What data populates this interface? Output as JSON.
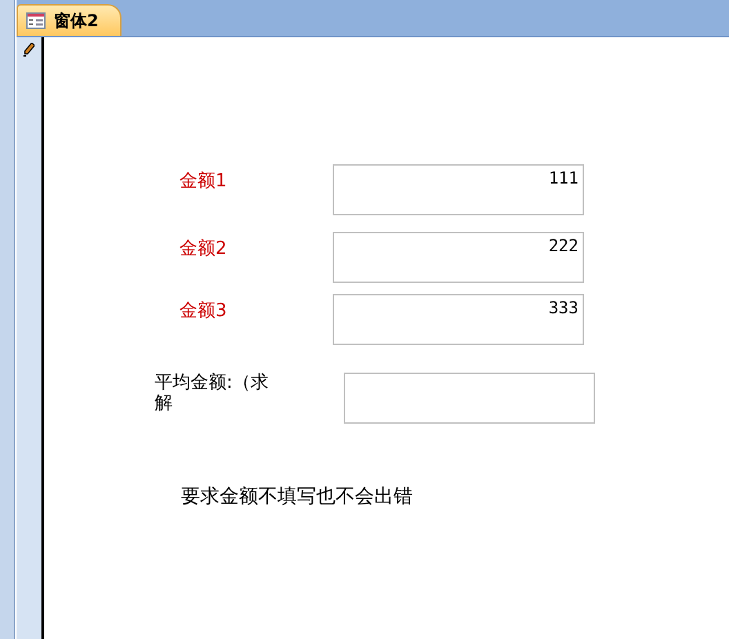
{
  "tab": {
    "title": "窗体2",
    "selected": true
  },
  "fields": [
    {
      "label": "金额1",
      "value": "111"
    },
    {
      "label": "金额2",
      "value": "222"
    },
    {
      "label": "金额3",
      "value": "333"
    }
  ],
  "average": {
    "label": "平均金额:（求解"
  },
  "note": "要求金额不填写也不会出错"
}
